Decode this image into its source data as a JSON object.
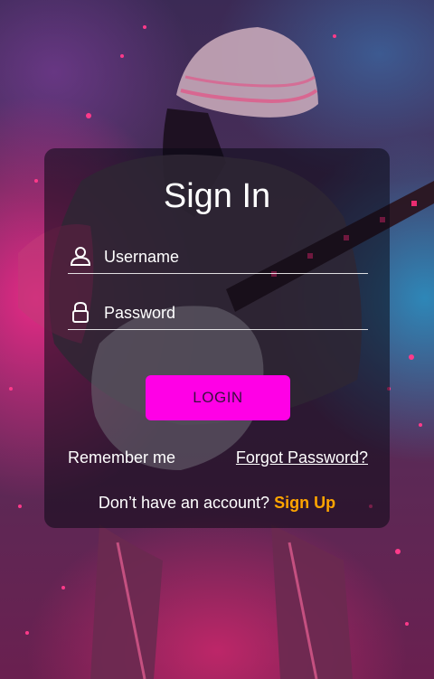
{
  "colors": {
    "accent": "#ff00e6",
    "signup_link": "#ffa500",
    "text": "#ffffff"
  },
  "background": {
    "description_icon": "guitarist-background-image"
  },
  "login_form": {
    "title": "Sign In",
    "username": {
      "placeholder": "Username",
      "value": "",
      "icon": "user-icon"
    },
    "password": {
      "placeholder": "Password",
      "value": "",
      "icon": "lock-icon"
    },
    "login_label": "LOGIN",
    "remember_label": "Remember me",
    "forgot_label": "Forgot Password?",
    "signup_prompt": "Don’t have an account?",
    "signup_label": "Sign Up"
  }
}
